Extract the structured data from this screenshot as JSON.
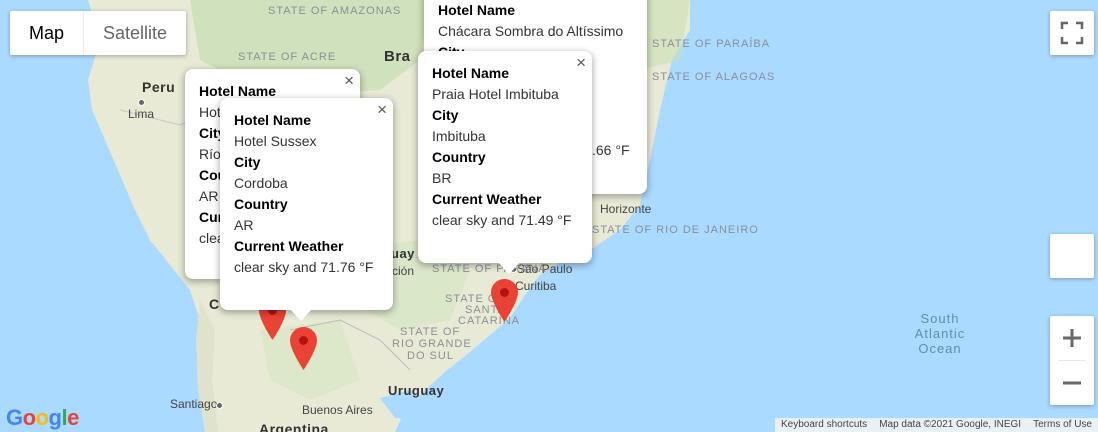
{
  "map_type": {
    "map_label": "Map",
    "satellite_label": "Satellite",
    "selected": "Map"
  },
  "colors": {
    "ocean": "#aadaff",
    "land": "#e8ead5",
    "land_green": "#c9dfb6",
    "marker": "#ea4335",
    "marker_dark": "#b31412"
  },
  "labels": {
    "state_amazonas": "STATE OF AMAZONAS",
    "state_acre": "STATE OF ACRE",
    "country_brazil_partial": "Bra",
    "country_peru": "Peru",
    "city_lima": "Lima",
    "state_paraiba": "STATE OF PARAÍBA",
    "state_alagoas": "STATE OF ALAGOAS",
    "city_horizonte": "Horizonte",
    "state_rio_partial": "STATE OF RIO DE JANEIRO",
    "city_sao_paulo": "São Paulo",
    "city_curitiba": "Curitiba",
    "state_parana": "STATE OF PARANÁ",
    "state_santa_catarina_1": "STATE OF",
    "state_santa_catarina_2": "SANTA",
    "state_santa_catarina_3": "CATARINA",
    "state_rio_grande_1": "STATE OF",
    "state_rio_grande_2": "RIO GRANDE",
    "state_rio_grande_3": "DO SUL",
    "country_uruguay": "Uruguay",
    "city_buenos_aires": "Buenos Aires",
    "city_santiago": "Santiago",
    "country_argentina": "Argentina",
    "ocean_1": "South",
    "ocean_2": "Atlantic",
    "ocean_3": "Ocean",
    "partial_c": "C",
    "partial_ucion": "ción",
    "partial_uay": "uay"
  },
  "info_windows": [
    {
      "id": "rio_cuarto",
      "hotel_label": "Hotel Name",
      "hotel_value": "Hot",
      "city_label": "City",
      "city_value": "Río",
      "country_label": "Cou",
      "country_value": "AR",
      "weather_label": "Cur",
      "weather_value": "clea"
    },
    {
      "id": "cordoba",
      "hotel_label": "Hotel Name",
      "hotel_value": "Hotel Sussex",
      "city_label": "City",
      "city_value": "Cordoba",
      "country_label": "Country",
      "country_value": "AR",
      "weather_label": "Current Weather",
      "weather_value": "clear sky and 71.76 °F"
    },
    {
      "id": "chacara",
      "hotel_label": "Hotel Name",
      "hotel_value": "Chácara Sombra do Altíssimo",
      "city_label": "City",
      "weather_value_partial": ".66 °F"
    },
    {
      "id": "imbituba",
      "hotel_label": "Hotel Name",
      "hotel_value": "Praia Hotel Imbituba",
      "city_label": "City",
      "city_value": "Imbituba",
      "country_label": "Country",
      "country_value": "BR",
      "weather_label": "Current Weather",
      "weather_value": "clear sky and 71.49 °F"
    }
  ],
  "close_glyph": "×",
  "footer": {
    "shortcuts": "Keyboard shortcuts",
    "map_data": "Map data ©2021 Google, INEGI",
    "terms": "Terms of Use"
  },
  "logo": {
    "g1": "G",
    "o1": "o",
    "o2": "o",
    "g2": "g",
    "l": "l",
    "e": "e"
  },
  "icons": {
    "fullscreen": "fullscreen-icon",
    "zoom_in": "plus-icon",
    "zoom_out": "minus-icon",
    "pegman": "pegman-icon",
    "close": "close-icon",
    "marker": "map-marker-icon"
  }
}
